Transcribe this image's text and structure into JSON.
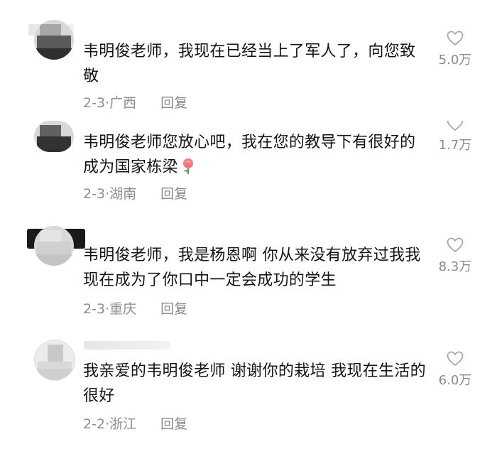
{
  "comments": [
    {
      "text": "韦明俊老师，我现在已经当上了军人了，向您致敬",
      "date": "2-3",
      "location": "广西",
      "reply_label": "回复",
      "likes": "5.0万"
    },
    {
      "text": "韦明俊老师您放心吧，我在您的教导下有很好的成为国家栋梁",
      "emoji": "rose-emoji",
      "date": "2-3",
      "location": "湖南",
      "reply_label": "回复",
      "likes": "1.7万"
    },
    {
      "text": "韦明俊老师，我是杨恩啊 你从来没有放弃过我我现在成为了你口中一定会成功的学生",
      "date": "2-3",
      "location": "重庆",
      "reply_label": "回复",
      "likes": "8.3万"
    },
    {
      "text": "我亲爱的韦明俊老师 谢谢你的栽培 我现在生活的很好",
      "date": "2-2",
      "location": "浙江",
      "reply_label": "回复",
      "likes": "6.0万"
    }
  ],
  "separator": "·",
  "icons": {
    "like": "heart-outline-icon",
    "emoji": "rose-emoji"
  },
  "colors": {
    "text": "#151515",
    "meta": "#8e8e8e",
    "icon": "#a8a8a8"
  }
}
